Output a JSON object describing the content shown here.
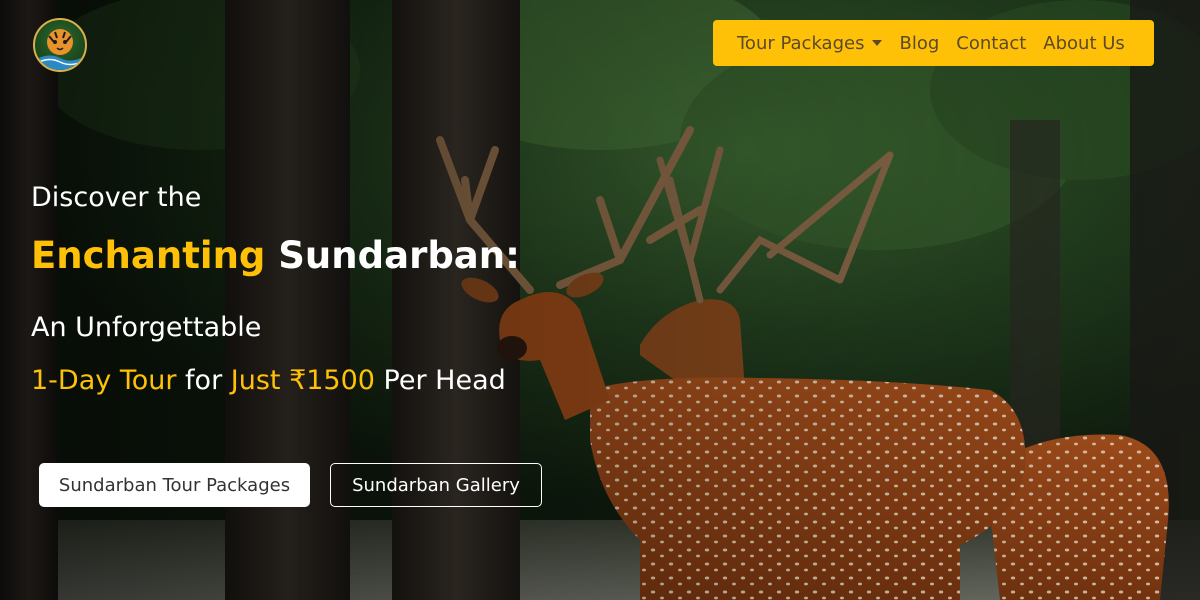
{
  "brand": {
    "logo_icon": "tiger-logo-icon"
  },
  "nav": {
    "items": [
      {
        "label": "Tour Packages",
        "has_dropdown": true
      },
      {
        "label": "Blog"
      },
      {
        "label": "Contact"
      },
      {
        "label": "About Us"
      }
    ],
    "background": "#ffc107",
    "text_color": "#5b4a2a"
  },
  "hero": {
    "line1": "Discover the",
    "line2_accent": "Enchanting",
    "line2_rest": " Sundarban:",
    "line3": "An Unforgettable",
    "line4_a": "1-Day Tour",
    "line4_b": " for ",
    "line4_c": "Just ₹1500",
    "line4_d": " Per Head",
    "accent_color": "#ffc107",
    "background_image": "spotted-deer-in-forest"
  },
  "buttons": {
    "primary_label": "Sundarban Tour Packages",
    "secondary_label": "Sundarban Gallery"
  }
}
